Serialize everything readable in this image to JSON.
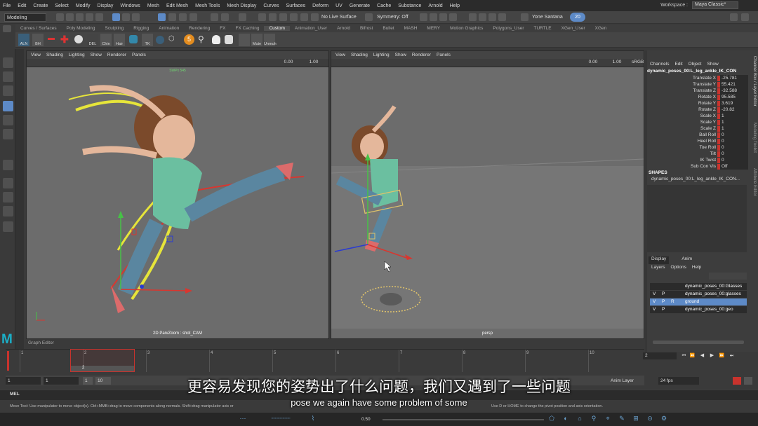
{
  "menubar": {
    "items": [
      "File",
      "Edit",
      "Create",
      "Select",
      "Modify",
      "Display",
      "Windows",
      "Mesh",
      "Edit Mesh",
      "Mesh Tools",
      "Mesh Display",
      "Curves",
      "Surfaces",
      "Deform",
      "UV",
      "Generate",
      "Cache",
      "Substance",
      "Arnold",
      "Help"
    ],
    "workspace_label": "Workspace :",
    "workspace_value": "Maya Classic*"
  },
  "statusline": {
    "mode": "Modeling",
    "live_surface": "No Live Surface",
    "symmetry": "Symmetry: Off",
    "user": "Yone Santana",
    "badge": "20"
  },
  "shelf": {
    "tabs": [
      "Curves / Surfaces",
      "Poly Modeling",
      "Sculpting",
      "Rigging",
      "Animation",
      "Rendering",
      "FX",
      "FX Caching",
      "Custom",
      "Animation_User",
      "Arnold",
      "Bifrost",
      "Bullet",
      "MASH",
      "MERY",
      "Motion Graphics",
      "Polygons_User",
      "TURTLE",
      "XGen_User",
      "XGen"
    ],
    "active_tab": "Custom",
    "buttons": [
      "ALN",
      "BH",
      "",
      "",
      "",
      "",
      "",
      "DEL",
      "Chin",
      "Hair",
      "",
      "TK",
      "",
      "",
      "",
      "",
      "5",
      "",
      "",
      "",
      "",
      "",
      "Mute",
      "Unmuh"
    ]
  },
  "left_viewport": {
    "menu": [
      "View",
      "Shading",
      "Lighting",
      "Show",
      "Renderer",
      "Panels"
    ],
    "field1": "0.00",
    "field2": "1.00",
    "camera": "2D Pan/Zoom : shot_CAM",
    "top_label": "SWPx 545"
  },
  "right_viewport": {
    "menu": [
      "View",
      "Shading",
      "Lighting",
      "Show",
      "Renderer",
      "Panels"
    ],
    "field1": "0.00",
    "field2": "1.00",
    "srgb": "sRGB",
    "camera": "persp"
  },
  "channel_box": {
    "menu": [
      "Channels",
      "Edit",
      "Object",
      "Show"
    ],
    "object": "dynamic_poses_00:L_leg_ankle_IK_CON",
    "attributes": [
      {
        "name": "Translate X",
        "value": "-25.781"
      },
      {
        "name": "Translate Y",
        "value": "55.421"
      },
      {
        "name": "Translate Z",
        "value": "-32.588"
      },
      {
        "name": "Rotate X",
        "value": "95.585"
      },
      {
        "name": "Rotate Y",
        "value": "3.619"
      },
      {
        "name": "Rotate Z",
        "value": "-20.82"
      },
      {
        "name": "Scale X",
        "value": "1"
      },
      {
        "name": "Scale Y",
        "value": "1"
      },
      {
        "name": "Scale Z",
        "value": "1"
      },
      {
        "name": "Ball Roll",
        "value": "0"
      },
      {
        "name": "Heel Roll",
        "value": "0"
      },
      {
        "name": "Toe Roll",
        "value": "0"
      },
      {
        "name": "Tilt",
        "value": "0"
      },
      {
        "name": "IK Twist",
        "value": "0"
      },
      {
        "name": "Sub Con Vis",
        "value": "Off"
      }
    ],
    "shapes_label": "SHAPES",
    "shape_name": "dynamic_poses_00:L_leg_ankle_IK_CON...",
    "side_tabs": [
      "Channel Box / Layer Editor",
      "Modeling Toolkit",
      "Attribute Editor"
    ]
  },
  "layer_editor": {
    "tabs": [
      "Display",
      "Anim"
    ],
    "active_tab": "Display",
    "menu": [
      "Layers",
      "Options",
      "Help"
    ],
    "layers": [
      {
        "v": "",
        "p": "",
        "r": "",
        "name": "dynamic_poses_00:Glasses",
        "selected": false
      },
      {
        "v": "V",
        "p": "P",
        "r": "",
        "name": "dynamic_poses_00:glasses",
        "selected": false
      },
      {
        "v": "V",
        "p": "P",
        "r": "R",
        "name": "ground",
        "selected": true
      },
      {
        "v": "V",
        "p": "P",
        "r": "",
        "name": "dynamic_poses_00:geo",
        "selected": false
      }
    ]
  },
  "timeline": {
    "graph_editor_label": "Graph Editor",
    "frame_labels": [
      "1",
      "2",
      "3",
      "4",
      "5",
      "6",
      "7",
      "8",
      "9",
      "10"
    ],
    "current_frame": "2",
    "current_frame_field": "2",
    "range_start": "1",
    "range_start2": "1",
    "range_inner": "1",
    "range_inner_end": "10",
    "fps": "24 fps",
    "anim_layer": "Anim Layer"
  },
  "playback": {
    "buttons": [
      "⏮",
      "⏪",
      "◀",
      "▶",
      "⏩",
      "⏭"
    ]
  },
  "mel": {
    "label": "MEL"
  },
  "help_line": "Move Tool: Use manipulator to move object(s). Ctrl+MMB+drag to move components along normals. Shift+drag manipulator axis or",
  "help_line_right": "Use D or HOME to change the pivot position and axis orientation.",
  "subtitle_cn": "更容易发现您的姿势出了什么问题，我们又遇到了一些问题",
  "subtitle_en": "pose we again have some problem of some",
  "bottom": {
    "zoom": "0.50"
  }
}
